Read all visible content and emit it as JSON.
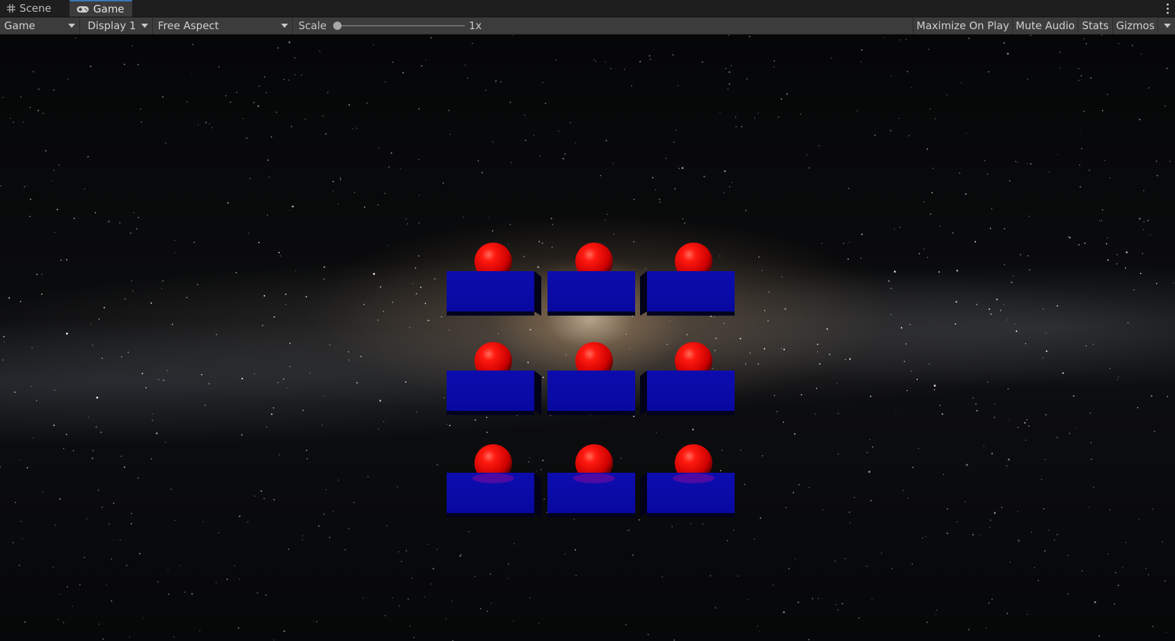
{
  "tabs": [
    {
      "label": "Scene",
      "icon": "grid-icon",
      "active": false
    },
    {
      "label": "Game",
      "icon": "gamepad-icon",
      "active": true
    }
  ],
  "toolbar": {
    "view_mode": "Game",
    "display": "Display 1",
    "aspect": "Free Aspect",
    "scale_label": "Scale",
    "scale_value": "1x",
    "maximize_on_play": "Maximize On Play",
    "mute_audio": "Mute Audio",
    "stats": "Stats",
    "gizmos": "Gizmos"
  },
  "scene": {
    "background": "milky-way-skybox",
    "grid": {
      "rows": 3,
      "columns": 3
    },
    "box_color": "#0a0aa8",
    "sphere_color": "#e00000"
  }
}
